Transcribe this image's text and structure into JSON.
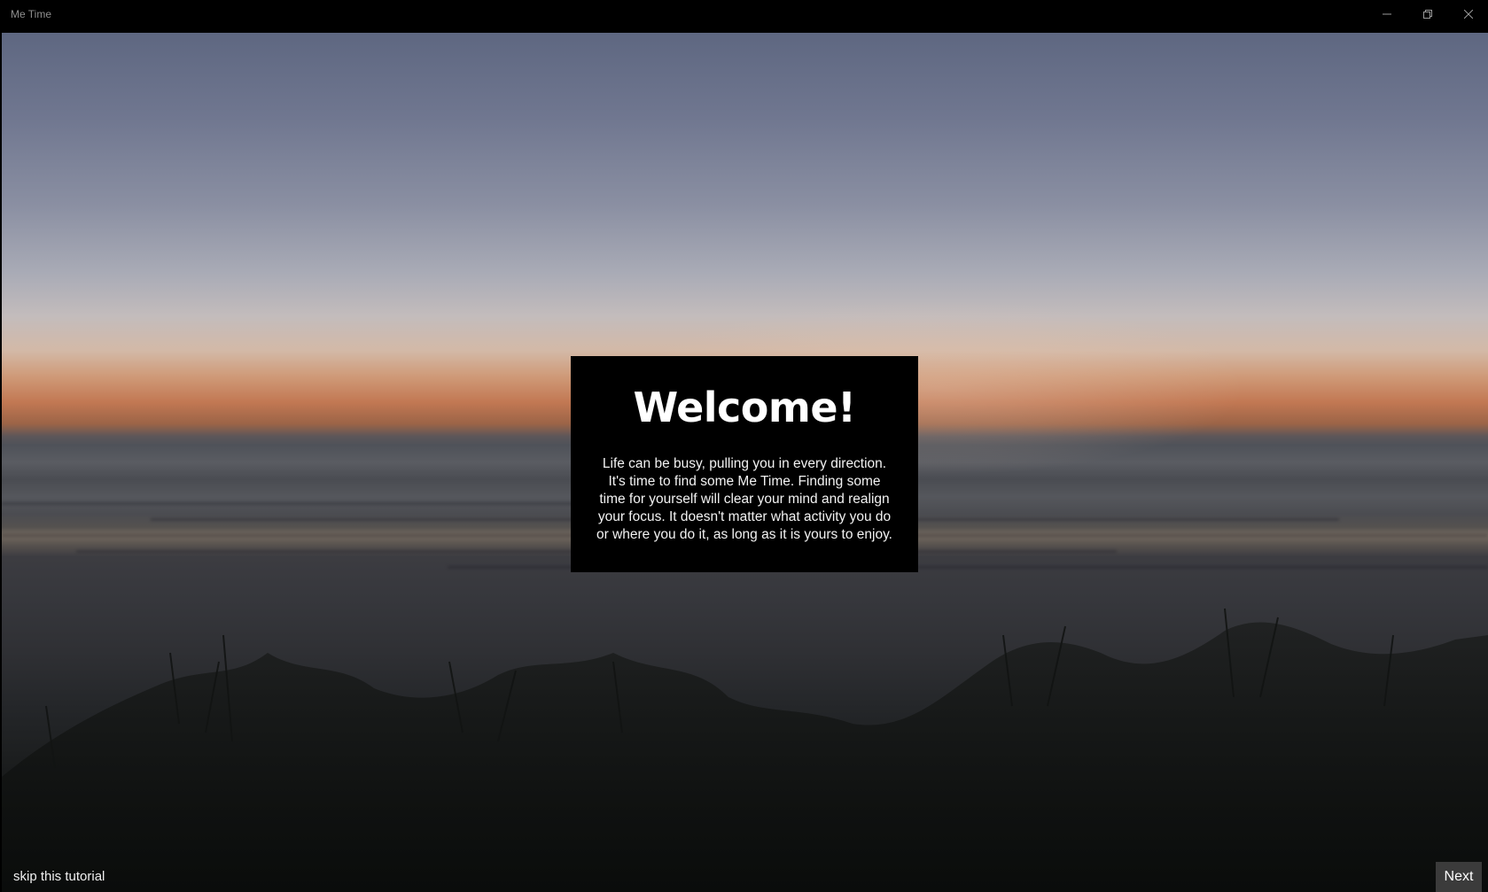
{
  "window": {
    "title": "Me Time",
    "controls": {
      "minimize_icon": "minimize-icon",
      "maximize_icon": "restore-icon",
      "close_icon": "close-icon"
    }
  },
  "welcome": {
    "title": "Welcome!",
    "body": "Life can be busy, pulling you in every direction. It's time to find some Me Time. Finding some time for yourself will clear your mind and realign your focus. It doesn't matter what activity you do or where you do it, as long as it is yours to enjoy."
  },
  "footer": {
    "skip_label": "skip this tutorial",
    "next_label": "Next"
  },
  "colors": {
    "card_background": "#000000",
    "next_button_background": "#3b3b3b",
    "text": "#ffffff"
  }
}
